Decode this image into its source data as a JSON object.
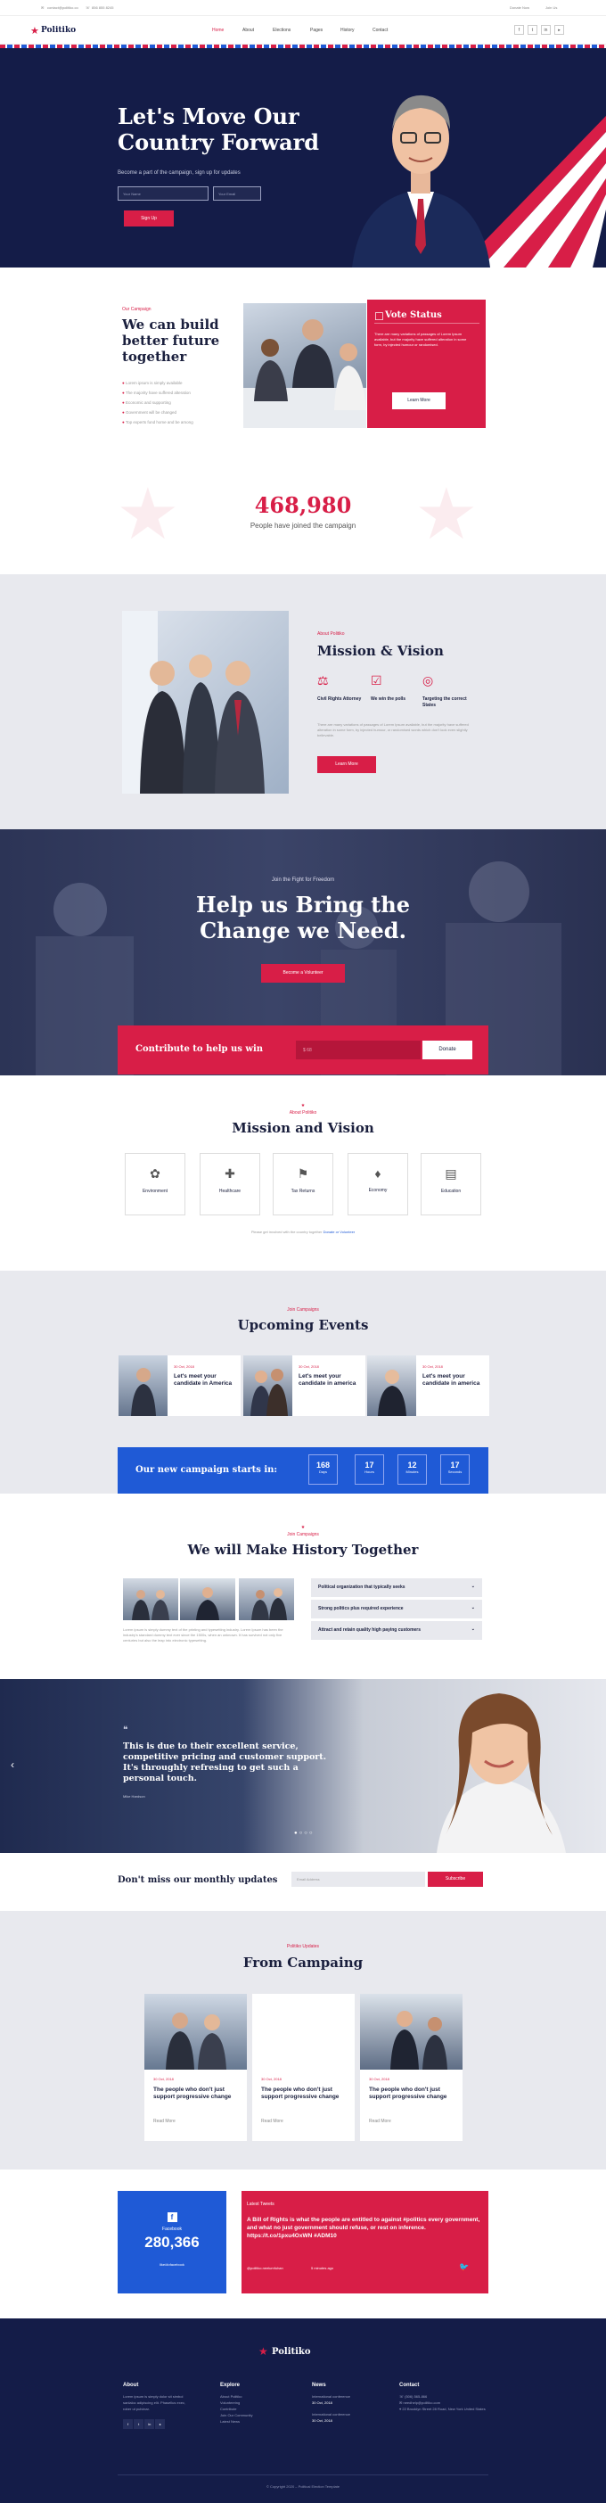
{
  "topbar": {
    "email": "contact@politiko.co",
    "phone": "856 855 8245",
    "donate": "Donate Now",
    "join": "Join Us"
  },
  "brand": {
    "name": "Politiko"
  },
  "nav": {
    "items": [
      "Home",
      "About",
      "Elections",
      "Pages",
      "History",
      "Contact"
    ],
    "social": [
      "f",
      "t",
      "in",
      "▸"
    ]
  },
  "hero": {
    "title": "Let's Move Our Country Forward",
    "subtitle": "Become a part of the campaign, sign up for updates",
    "name_placeholder": "Your Name",
    "email_placeholder": "Your Email",
    "signup": "Sign Up"
  },
  "campaign": {
    "eyebrow": "Our Campaign",
    "title": "We can build better future together",
    "items": [
      "Lorem ipsum is simply available",
      "The majority have suffered alteration",
      "Economic and supporting",
      "Government will be changed",
      "Top experts fund home and be among"
    ]
  },
  "vote": {
    "title": "Vote Status",
    "text": "There are many variations of passages of Lorem Ipsum available, but the majority have suffered alteration in some form, by injected humour or randomised.",
    "button": "Learn More"
  },
  "counter": {
    "number": "468,980",
    "label": "People have joined the campaign"
  },
  "mission": {
    "eyebrow": "About Politiko",
    "title": "Mission & Vision",
    "features": [
      "Civil Rights Attorney",
      "We win the polls",
      "Targeting the correct States"
    ],
    "text": "There are many variations of passages of Lorem Ipsum available, but the majority have suffered alteration in some form, by injected humour, or randomised words which don't look even slightly believable.",
    "button": "Learn More"
  },
  "fight": {
    "eyebrow": "Join the Fight for Freedom",
    "title": "Help us Bring the Change we Need.",
    "button": "Become a Volunteer"
  },
  "contribute": {
    "label": "Contribute to help us win",
    "placeholder": "$ 68",
    "button": "Donate"
  },
  "about2": {
    "eyebrow": "About Politiko",
    "title": "Mission and Vision",
    "items": [
      "Environment",
      "Healthcare",
      "Tax Returns",
      "Economy",
      "Education"
    ],
    "note": "Please get involved with the country together ",
    "note_link": "Donate or Volunteer"
  },
  "events": {
    "eyebrow": "Join Campaigns",
    "title": "Upcoming Events",
    "items": [
      {
        "date": "30 Oct, 2018",
        "title": "Let's meet your candidate in America"
      },
      {
        "date": "30 Oct, 2018",
        "title": "Let's meet your candidate in america"
      },
      {
        "date": "30 Oct, 2018",
        "title": "Let's meet your candidate in america"
      }
    ]
  },
  "countdown": {
    "label": "Our new campaign starts in:",
    "units": [
      {
        "value": "168",
        "label": "Days"
      },
      {
        "value": "17",
        "label": "Hours"
      },
      {
        "value": "12",
        "label": "Minutes"
      },
      {
        "value": "17",
        "label": "Seconds"
      }
    ]
  },
  "history": {
    "eyebrow": "Join Campaigns",
    "title": "We will Make History Together",
    "text": "Lorem ipsum is simply dummy text of the printing and typesetting industry. Lorem Ipsum has been the industry's standard dummy text ever since the 1500s, when an unknown. It has survived not only five centuries but also the leap into electronic typesetting.",
    "accordion": [
      "Political organization that typically seeks",
      "Strong politics plus required experience",
      "Attract and retain quality high paying customers"
    ]
  },
  "testimonial": {
    "quote": "This is due to their excellent service, competitive pricing and customer support. It's throughly refresing to get such a personal touch.",
    "author": "Mike Hardson"
  },
  "newsletter": {
    "title": "Don't miss our monthly updates",
    "placeholder": "Email Address",
    "button": "Subscribe"
  },
  "updates": {
    "eyebrow": "Politiko Updates",
    "title": "From Campaing",
    "items": [
      {
        "date": "30 Oct, 2018",
        "title": "The people who don't just support progressive change",
        "more": "Read More"
      },
      {
        "date": "30 Oct, 2018",
        "title": "The people who don't just support progressive change",
        "more": "Read More"
      },
      {
        "date": "30 Oct, 2018",
        "title": "The people who don't just support progressive change",
        "more": "Read More"
      }
    ]
  },
  "facebook": {
    "label": "Facebook",
    "count": "280,366",
    "link": "like/#ofacebook"
  },
  "tweets": {
    "label": "Latest Tweets",
    "text": "A Bill of Rights is what the people are entitled to against #politics every government, and what no just government should refuse, or rest on inference. https://t.co/1pxu4OxWN #ADM10",
    "handle": "@politiko.neelumfuhan",
    "time": "5 minutes ago"
  },
  "footer": {
    "brand": "Politiko",
    "about_title": "About",
    "about_text": "Lorem ipsum is simply dolor sit simbol sanlaloc adipiscing elit. Phasellus exec, rober ut pulvinar.",
    "explore_title": "Explore",
    "explore": [
      "About Politiko",
      "Volunteering",
      "Contribute",
      "Join Our Community",
      "Latest News"
    ],
    "news_title": "News",
    "news": [
      {
        "title": "International conference",
        "date": "30 Oct, 2018"
      },
      {
        "title": "International conference",
        "date": "30 Oct, 2018"
      }
    ],
    "contact_title": "Contact",
    "contact": [
      "(506) 565-866",
      "needhelp@politiko.com",
      "22 Brooklyn Street 28 Road, New York United States"
    ],
    "copyright": "© Copyright 2020 – Political Election Template"
  },
  "colors": {
    "navy": "#141c48",
    "red": "#d81e47",
    "blue": "#1f5ad6"
  }
}
